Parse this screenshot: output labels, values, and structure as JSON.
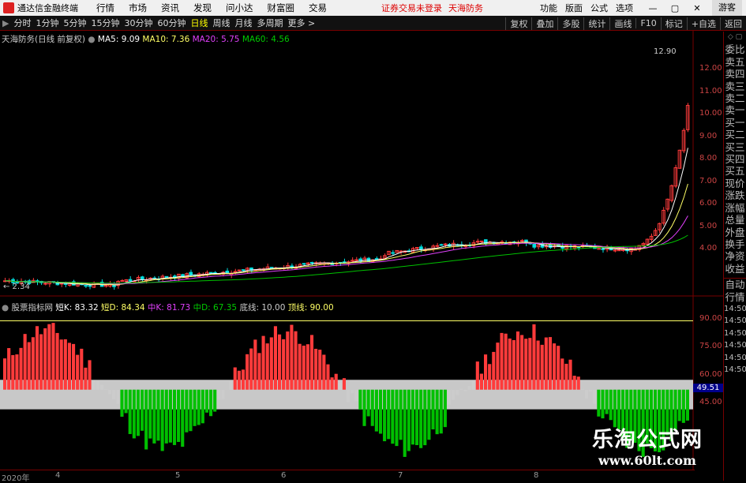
{
  "titlebar": {
    "app_name": "通达信金融终端",
    "menu": [
      "行情",
      "市场",
      "资讯",
      "发现",
      "问小达",
      "财富圈",
      "交易"
    ],
    "red_1": "证券交易未登录",
    "red_2": "天海防务",
    "right": [
      "功能",
      "版面",
      "公式",
      "选项"
    ],
    "win": [
      "—",
      "▢",
      "✕"
    ],
    "guest": "游客"
  },
  "toolbar": {
    "periods": [
      "分时",
      "1分钟",
      "5分钟",
      "15分钟",
      "30分钟",
      "60分钟",
      "日线",
      "周线",
      "月线",
      "多周期",
      "更多 >"
    ],
    "active": "日线",
    "right": [
      "复权",
      "叠加",
      "多股",
      "统计",
      "画线",
      "F10",
      "标记",
      "+自选",
      "返回"
    ]
  },
  "main_info": {
    "name": "天海防务(日线 前复权)",
    "ma5": "MA5: 9.09",
    "ma10": "MA10: 7.36",
    "ma20": "MA20: 5.75",
    "ma60": "MA60: 4.56",
    "high": "12.90",
    "low": "← 2.34"
  },
  "price_axis": [
    "12.00",
    "11.00",
    "10.00",
    "9.00",
    "8.00",
    "7.00",
    "6.00",
    "5.00",
    "4.00"
  ],
  "sub_info": {
    "name": "股票指标网",
    "dk": "短K: 83.32",
    "dd": "短D: 84.34",
    "mk": "中K: 81.73",
    "md": "中D: 67.35",
    "bl": "底线: 10.00",
    "tl": "顶线: 90.00"
  },
  "sub_axis": [
    "90.00",
    "75.00",
    "60.00",
    "45.00"
  ],
  "sub_current": "49.51",
  "right_tabs": [
    "委比",
    "卖五",
    "卖四",
    "卖三",
    "卖二",
    "卖一",
    "买一",
    "买二",
    "买三",
    "买四",
    "买五",
    "现价",
    "涨跌",
    "涨幅",
    "总量",
    "外盘",
    "换手",
    "净资",
    "收益"
  ],
  "right_tabs2": [
    "自动",
    "行情"
  ],
  "times": [
    "14:50",
    "14:50",
    "14:50",
    "14:50",
    "14:50",
    "14:50",
    "14:50"
  ],
  "xaxis": [
    "2020年",
    "4",
    "5",
    "6",
    "7",
    "8"
  ],
  "watermark": {
    "line1": "乐淘公式网",
    "line2": "www.60lt.com"
  },
  "chart_data": {
    "type": "candlestick",
    "xlabels": [
      "2020年",
      "4",
      "5",
      "6",
      "7",
      "8"
    ],
    "price_range": [
      2.34,
      12.9
    ],
    "ma": {
      "MA5": 9.09,
      "MA10": 7.36,
      "MA20": 5.75,
      "MA60": 4.56
    },
    "sub_indicator": {
      "短K": 83.32,
      "短D": 84.34,
      "中K": 81.73,
      "中D": 67.35,
      "底线": 10,
      "顶线": 90
    },
    "sub_range": [
      45,
      90
    ]
  },
  "colors": {
    "up": "#ff3b3b",
    "down": "#00e0e0",
    "ma5": "#ffffff",
    "ma10": "#ffff66",
    "ma20": "#e040fb",
    "ma60": "#00c000"
  }
}
